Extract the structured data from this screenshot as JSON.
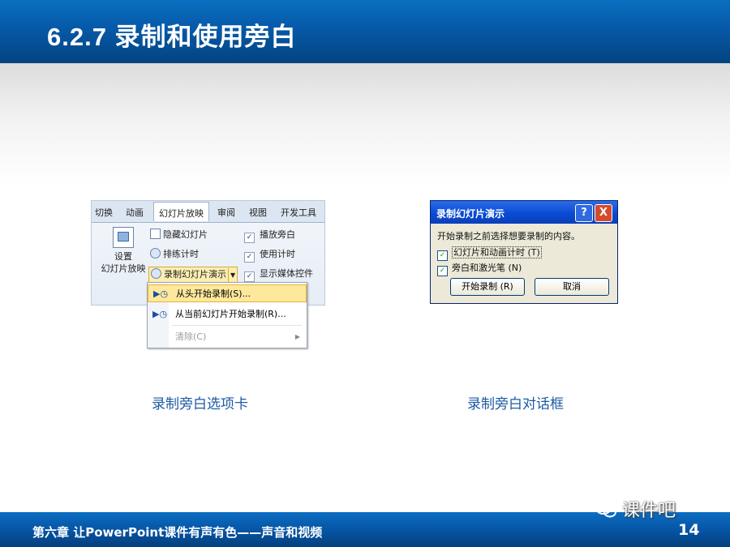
{
  "slide_title": "6.2.7 录制和使用旁白",
  "ribbon": {
    "tabs": [
      "切换",
      "动画",
      "幻灯片放映",
      "审阅",
      "视图",
      "开发工具"
    ],
    "active_tab": "幻灯片放映",
    "setup_line1": "设置",
    "setup_line2": "幻灯片放映",
    "hide_slide": "隐藏幻灯片",
    "rehearse": "排练计时",
    "record_show": "录制幻灯片演示",
    "play_narration": "播放旁白",
    "use_timings": "使用计时",
    "show_media_controls": "显示媒体控件"
  },
  "dropdown": {
    "items": [
      "从头开始录制(S)...",
      "从当前幻灯片开始录制(R)...",
      "清除(C)"
    ]
  },
  "dialog": {
    "title": "录制幻灯片演示",
    "help": "?",
    "close": "X",
    "prompt": "开始录制之前选择想要录制的内容。",
    "option1": "幻灯片和动画计时 (T)",
    "option2": "旁白和激光笔 (N)",
    "start_button": "开始录制 (R)",
    "cancel_button": "取消"
  },
  "captions": {
    "left": "录制旁白选项卡",
    "right": "录制旁白对话框"
  },
  "footer": {
    "chapter": "第六章   让PowerPoint课件有声有色——声音和视频",
    "page": "14"
  },
  "watermark": "课件吧"
}
